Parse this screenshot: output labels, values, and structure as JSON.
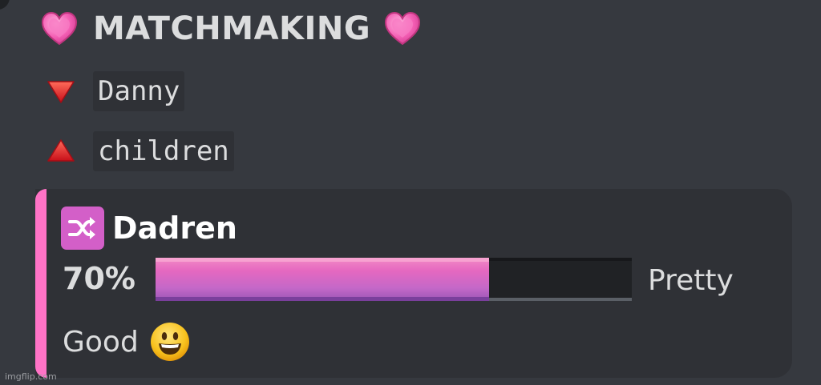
{
  "header": {
    "title": "MATCHMAKING",
    "left_icon": "pink-heart-icon",
    "right_icon": "pink-heart-icon"
  },
  "names": [
    {
      "icon": "red-down-triangle-icon",
      "label": "Danny"
    },
    {
      "icon": "red-up-triangle-icon",
      "label": "children"
    }
  ],
  "embed": {
    "accent_color": "#ff73c6",
    "icon": "shuffle-icon",
    "ship_name": "Dadren",
    "percent_label": "70%",
    "progress_fraction": 0.7,
    "rating_word_1": "Pretty",
    "rating_word_2": "Good",
    "rating_icon": "smiley-face-icon"
  },
  "watermark": "imgflip.com"
}
